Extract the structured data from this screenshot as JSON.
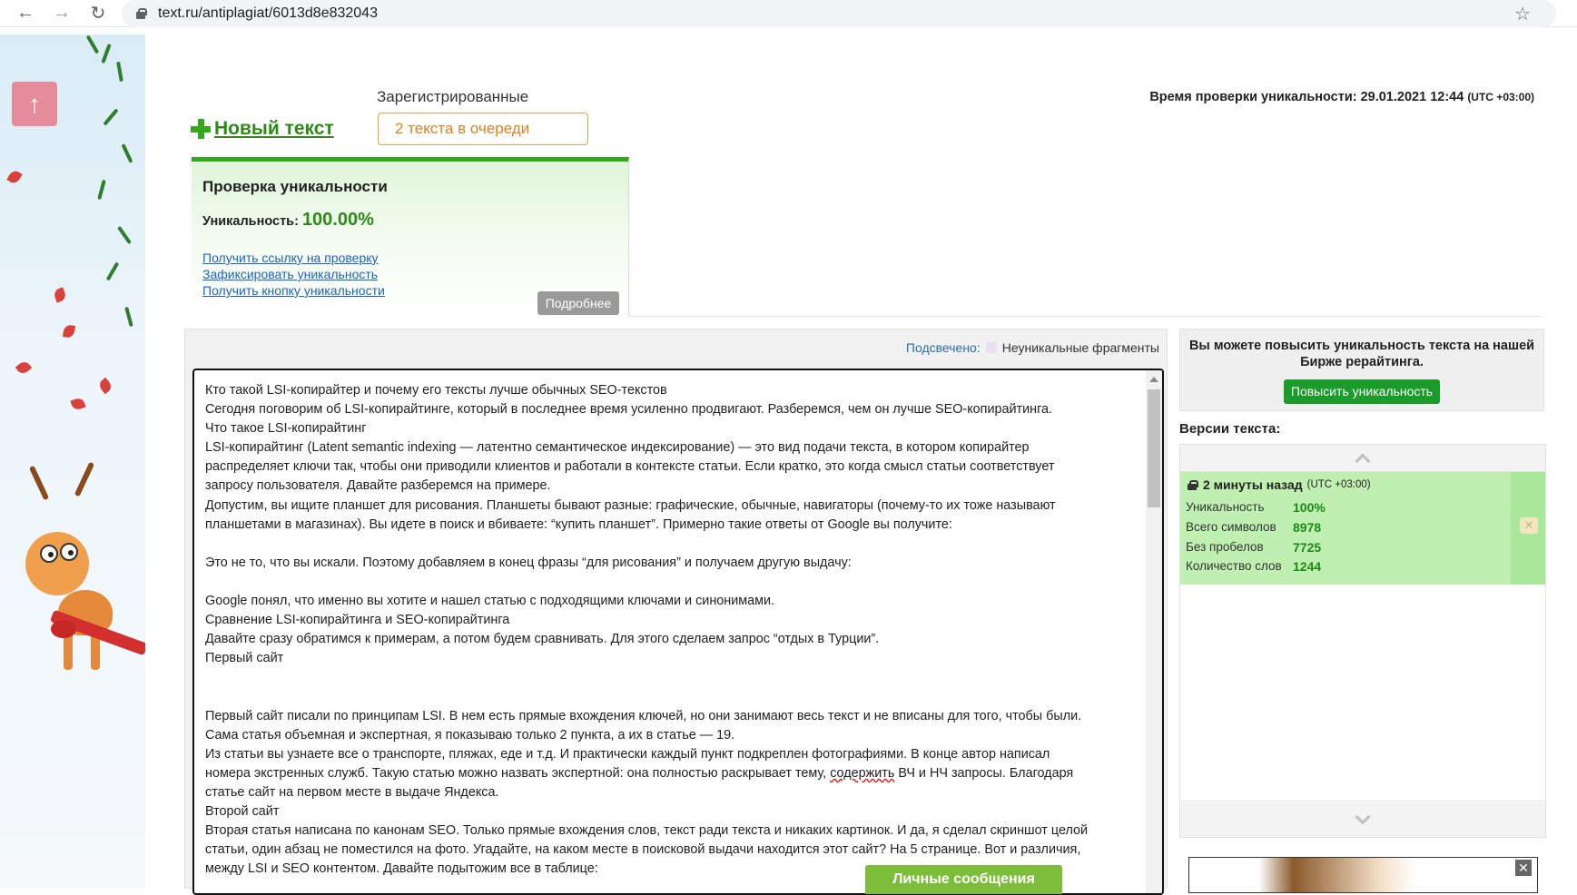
{
  "browser": {
    "url": "text.ru/antiplagiat/6013d8e832043"
  },
  "header": {
    "new_text": "Новый текст",
    "registered_label": "Зарегистрированные",
    "queue": "2 текста в очереди",
    "check_time_label": "Время проверки уникальности: 29.01.2021 12:44",
    "check_time_tz": "(UTC +03:00)"
  },
  "result": {
    "title": "Проверка уникальности",
    "uniqueness_label": "Уникальность:",
    "uniqueness_value": "100.00%",
    "links": [
      "Получить ссылку на проверку",
      "Зафиксировать уникальность",
      "Получить кнопку уникальности"
    ],
    "more_button": "Подробнее"
  },
  "text_panel": {
    "legend_label": "Подсвечено:",
    "legend_value": "Неуникальные фрагменты",
    "lines": [
      "Кто такой LSI-копирайтер и почему его тексты лучше обычных SEO-текстов",
      "Сегодня поговорим об LSI-копирайтинге, который в последнее время усиленно продвигают. Разберемся, чем он лучше SEO-копирайтинга.",
      "Что такое LSI-копирайтинг",
      "LSI-копирайтинг (Latent semantic indexing — латентно семантическое индексирование) — это вид подачи текста, в котором копирайтер",
      "распределяет ключи так, чтобы они приводили клиентов и работали в контексте статьи. Если кратко, это когда смысл статьи соответствует",
      "запросу пользователя. Давайте разберемся на примере.",
      "Допустим, вы ищите планшет для рисования. Планшеты бывают разные: графические, обычные, навигаторы (почему-то их тоже называют",
      "планшетами в магазинах). Вы идете в поиск и вбиваете: “купить планшет”. Примерно такие ответы от Google вы получите:",
      "",
      "Это не то, что вы искали. Поэтому добавляем в конец фразы “для рисования” и получаем другую выдачу:",
      "",
      "Google понял, что именно вы хотите и нашел статью с подходящими ключами и синонимами.",
      "Сравнение LSI-копирайтинга и SEO-копирайтинга",
      "Давайте сразу обратимся к примерам, а потом будем сравнивать. Для этого сделаем запрос “отдых в Турции”.",
      "Первый сайт",
      "",
      "",
      "Первый сайт писали по принципам LSI. В нем есть прямые вхождения ключей, но они занимают весь текст и не вписаны для того, чтобы были.",
      "Сама статья объемная и экспертная, я показываю только 2 пункта, а их в статье — 19.",
      "Из статьи вы узнаете все о транспорте, пляжах, еде и т.д. И практически каждый пункт подкреплен фотографиями. В конце автор написал",
      "номера экстренных служб. Такую статью можно назвать экспертной: она полностью раскрывает тему, содержить ВЧ и НЧ запросы. Благодаря",
      "статье сайт на первом месте в выдаче Яндекса.",
      "Второй сайт",
      "Вторая статья написана по канонам SEO. Только прямые вхождения слов, текст ради текста и никаких картинок. И да, я сделал скриншот целой",
      "статьи, один абзац не поместился на фото. Угадайте, на каком месте в поисковой выдачи находится этот сайт? На 5 странице. Вот и различия,",
      "между LSI и SEO контентом. Давайте подытожим все в таблице:"
    ],
    "pm_button": "Личные сообщения"
  },
  "sidebar": {
    "boost_text": "Вы можете повысить уникальность текста на нашей Бирже рерайтинга.",
    "boost_button": "Повысить уникальность",
    "versions_title": "Версии текста:",
    "version": {
      "time": "2 минуты назад",
      "tz": "(UTC +03:00)",
      "rows": [
        {
          "label": "Уникальность",
          "value": "100%"
        },
        {
          "label": "Всего символов",
          "value": "8978"
        },
        {
          "label": "Без пробелов",
          "value": "7725"
        },
        {
          "label": "Количество слов",
          "value": "1244"
        }
      ]
    }
  },
  "colors": {
    "green_accent": "#34a91e",
    "link": "#1a64c4",
    "queue_orange": "#e67f1e"
  }
}
